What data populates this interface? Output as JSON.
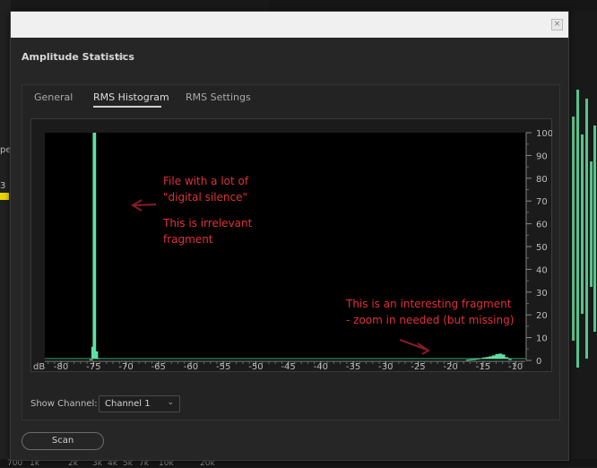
{
  "background": {
    "left_label_1": "pe",
    "left_label_2": "3",
    "bottom_ticks": [
      "700",
      "1k",
      "2k",
      "3k",
      "4k",
      "5k",
      "7k",
      "10k",
      "20k"
    ]
  },
  "dialog": {
    "close_symbol": "×",
    "title": "Amplitude Statistics",
    "menu_icon": "≡",
    "tabs": [
      {
        "label": "General",
        "active": false
      },
      {
        "label": "RMS Histogram",
        "active": true
      },
      {
        "label": "RMS Settings",
        "active": false
      }
    ],
    "show_channel_label": "Show Channel:",
    "channel_value": "Channel 1",
    "scan_label": "Scan"
  },
  "chart_data": {
    "type": "bar",
    "xlabel": "dB",
    "x_ticks": [
      -80,
      -75,
      -70,
      -65,
      -60,
      -55,
      -50,
      -45,
      -40,
      -35,
      -30,
      -25,
      -20,
      -15,
      -10
    ],
    "xlim": [
      -82.5,
      -8.5
    ],
    "y_ticks": [
      0,
      10,
      20,
      30,
      40,
      50,
      60,
      70,
      80,
      90,
      100
    ],
    "ylim": [
      0,
      100
    ],
    "y_axis_position": "right",
    "bar_color": "#5fe0a3",
    "series": [
      {
        "values": [
          {
            "x": -75.5,
            "y": 0.5
          },
          {
            "x": -75.2,
            "y": 6
          },
          {
            "x": -75.0,
            "y": 100
          },
          {
            "x": -74.7,
            "y": 4
          },
          {
            "x": -74.4,
            "y": 1
          }
        ]
      },
      {
        "values": [
          {
            "x": -17.5,
            "y": 0.3
          },
          {
            "x": -17.0,
            "y": 0.5
          },
          {
            "x": -16.5,
            "y": 0.6
          },
          {
            "x": -16.0,
            "y": 0.8
          },
          {
            "x": -15.5,
            "y": 1.0
          },
          {
            "x": -15.0,
            "y": 1.3
          },
          {
            "x": -14.5,
            "y": 1.5
          },
          {
            "x": -14.0,
            "y": 1.8
          },
          {
            "x": -13.5,
            "y": 2.2
          },
          {
            "x": -13.0,
            "y": 2.8
          },
          {
            "x": -12.5,
            "y": 3.0
          },
          {
            "x": -12.0,
            "y": 2.6
          },
          {
            "x": -11.5,
            "y": 1.4
          },
          {
            "x": -11.0,
            "y": 0.6
          }
        ]
      }
    ],
    "annotations": [
      {
        "lines": [
          "File with a lot of",
          "\"digital silence\""
        ],
        "color": "#e0303a"
      },
      {
        "lines": [
          "This is irrelevant",
          "fragment"
        ],
        "color": "#e0303a"
      },
      {
        "lines": [
          "This is an interesting fragment",
          "- zoom in needed (but missing)"
        ],
        "color": "#e0303a"
      }
    ]
  }
}
